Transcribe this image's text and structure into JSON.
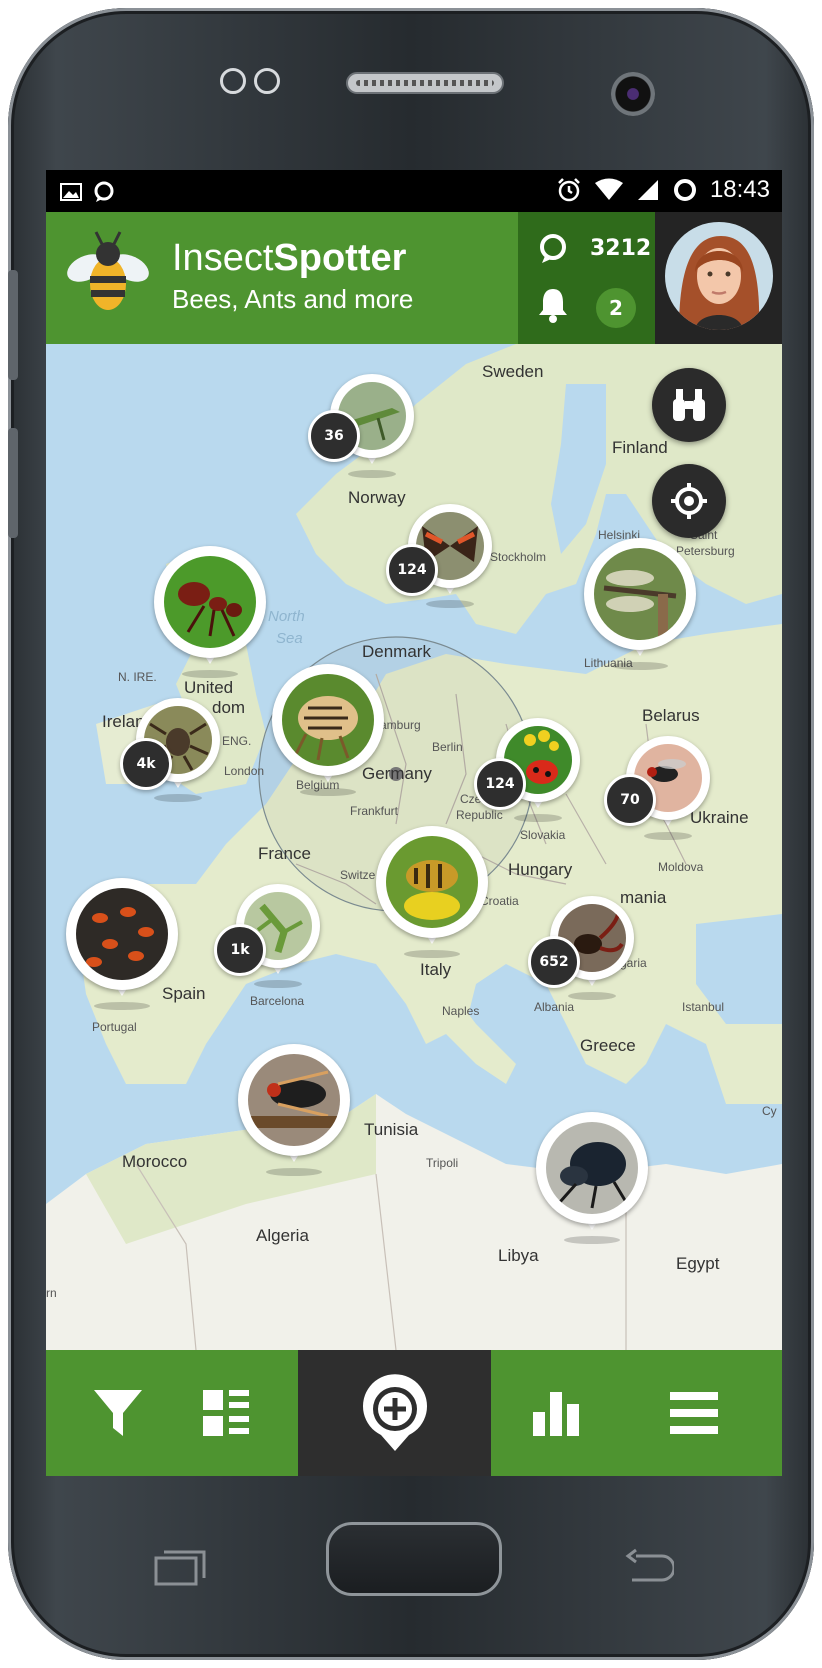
{
  "status_bar": {
    "time": "18:43",
    "icons": [
      "image-icon",
      "chat-bubble-icon",
      "alarm-icon",
      "wifi-icon",
      "signal-icon",
      "battery-ring-icon"
    ]
  },
  "app_header": {
    "brand_prefix": "Insect",
    "brand_suffix": "Spotter",
    "tagline": "Bees, Ants and more",
    "logo_icon": "bee-icon",
    "points_icon": "points-icon",
    "points": "3212",
    "notifications_icon": "bell-icon",
    "notifications_count": "2",
    "avatar_icon": "user-avatar"
  },
  "map": {
    "labels": {
      "sweden": "Sweden",
      "finland": "Finland",
      "norway": "Norway",
      "helsinki": "Helsinki",
      "saint": "Saint",
      "petersburg": "Petersburg",
      "stockholm": "Stockholm",
      "north": "North",
      "sea": "Sea",
      "denmark": "Denmark",
      "n_ire": "N. IRE.",
      "united": "United",
      "kingdom_tail": "dom",
      "ireland_head": "Irelan",
      "eng": "ENG.",
      "london": "London",
      "hamburg_tail": "amburg",
      "berlin": "Berlin",
      "lithuania": "Lithuania",
      "belarus": "Belarus",
      "germany": "Germany",
      "belgium": "Belgium",
      "frankfurt": "Frankfurt",
      "czech": "Czech",
      "republic": "Republic",
      "ukraine": "Ukraine",
      "slovakia": "Slovakia",
      "france": "France",
      "hungary": "Hungary",
      "moldova": "Moldova",
      "switzerland_head": "Switze",
      "croatia": "Croatia",
      "romania_tail": "mania",
      "bulgaria_tail": "garia",
      "spain": "Spain",
      "portugal": "Portugal",
      "barcelona": "Barcelona",
      "italy": "Italy",
      "naples": "Naples",
      "albania": "Albania",
      "istanbul": "Istanbul",
      "greece": "Greece",
      "tunisia": "Tunisia",
      "morocco": "Morocco",
      "tripoli": "Tripoli",
      "cyprus_head": "Cy",
      "algeria": "Algeria",
      "libya": "Libya",
      "egypt": "Egypt",
      "edge_rn": "rn"
    },
    "clusters": {
      "norway": "36",
      "sweden": "124",
      "ireland": "4k",
      "germany_east": "124",
      "belarus": "70",
      "spain": "1k",
      "balkans": "652"
    },
    "pins": [
      {
        "name": "grasshopper-pin",
        "subject": "grasshopper"
      },
      {
        "name": "butterfly-pin",
        "subject": "butterfly"
      },
      {
        "name": "ant-pin",
        "subject": "red ant"
      },
      {
        "name": "dragonfly-pin",
        "subject": "dragonfly"
      },
      {
        "name": "jumping-spider-pin",
        "subject": "jumping spider"
      },
      {
        "name": "potato-beetle-pin",
        "subject": "colorado potato beetle"
      },
      {
        "name": "ladybug-pin",
        "subject": "ladybug"
      },
      {
        "name": "fly-pin",
        "subject": "fly"
      },
      {
        "name": "bee-pin",
        "subject": "bee"
      },
      {
        "name": "firebugs-pin",
        "subject": "firebugs"
      },
      {
        "name": "mantis-pin",
        "subject": "mantis"
      },
      {
        "name": "stag-beetle-pin",
        "subject": "stag beetle"
      },
      {
        "name": "cicada-pin",
        "subject": "cicada"
      },
      {
        "name": "dung-beetle-pin",
        "subject": "dung beetle"
      }
    ],
    "controls": [
      "binoculars-icon",
      "locate-icon"
    ]
  },
  "bottom_nav": {
    "items": [
      "filter-icon",
      "list-view-icon",
      "add-sighting-icon",
      "statistics-icon",
      "menu-icon"
    ]
  },
  "colors": {
    "primary": "#4e9430",
    "primary_dark": "#2f6b1b",
    "dark": "#2e2e2e"
  }
}
